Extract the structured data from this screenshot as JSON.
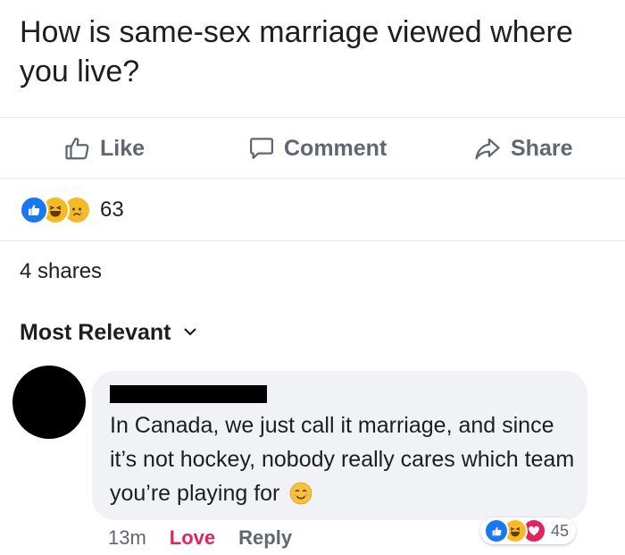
{
  "post": {
    "text": "How is same-sex marriage viewed where you live?"
  },
  "actions": {
    "like_label": "Like",
    "comment_label": "Comment",
    "share_label": "Share"
  },
  "reactions": {
    "icons": [
      "like-icon",
      "haha-icon",
      "sad-icon"
    ],
    "count": "63"
  },
  "shares_text": "4 shares",
  "sort": {
    "label": "Most Relevant",
    "icon": "chevron-down-icon"
  },
  "comment": {
    "text": "In Canada, we just call it marriage, and since it’s not hockey, nobody really cares which team you’re playing for",
    "emoji": "smiling-face-icon",
    "time": "13m",
    "love_label": "Love",
    "reply_label": "Reply",
    "reactions": {
      "icons": [
        "like-icon",
        "haha-icon",
        "love-icon"
      ],
      "count": "45"
    }
  },
  "colors": {
    "like_blue": "#1877f2",
    "love_red": "#e0245e",
    "haha_yellow": "#f7b928",
    "muted_text": "#606770",
    "bubble_bg": "#f0f2f5"
  }
}
